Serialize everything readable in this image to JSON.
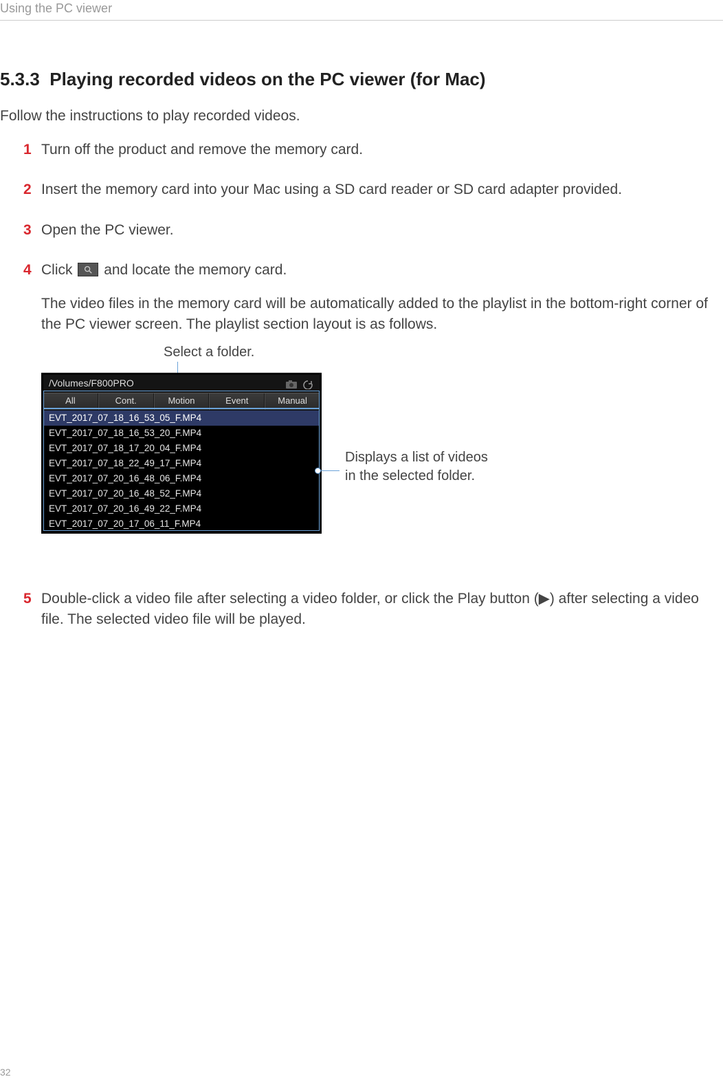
{
  "header": "Using the PC viewer",
  "section": {
    "number": "5.3.3",
    "title": "Playing recorded videos on the PC viewer (for Mac)"
  },
  "intro": "Follow the instructions to play recorded videos.",
  "steps": {
    "s1": "Turn off the product and remove the memory card.",
    "s2": "Insert the memory card into your Mac using a SD card reader or SD card adapter provided.",
    "s3": "Open the PC viewer.",
    "s4_a": "Click",
    "s4_b": "and locate the memory card.",
    "s4_desc": "The video files in the memory card will be automatically added to the playlist in the bottom-right corner of the PC viewer screen. The playlist section layout is as follows.",
    "s5": "Double-click a video file after selecting a video folder, or click the Play button (▶) after selecting a video file. The selected video file will be played."
  },
  "figure": {
    "folder_label": "Select a folder.",
    "list_label_l1": "Displays a list of videos",
    "list_label_l2": "in the selected folder.",
    "path": "/Volumes/F800PRO",
    "tabs": [
      "All",
      "Cont.",
      "Motion",
      "Event",
      "Manual"
    ],
    "files": [
      "EVT_2017_07_18_16_53_05_F.MP4",
      "EVT_2017_07_18_16_53_20_F.MP4",
      "EVT_2017_07_18_17_20_04_F.MP4",
      "EVT_2017_07_18_22_49_17_F.MP4",
      "EVT_2017_07_20_16_48_06_F.MP4",
      "EVT_2017_07_20_16_48_52_F.MP4",
      "EVT_2017_07_20_16_49_22_F.MP4",
      "EVT_2017_07_20_17_06_11_F.MP4"
    ]
  },
  "page_number": "32"
}
